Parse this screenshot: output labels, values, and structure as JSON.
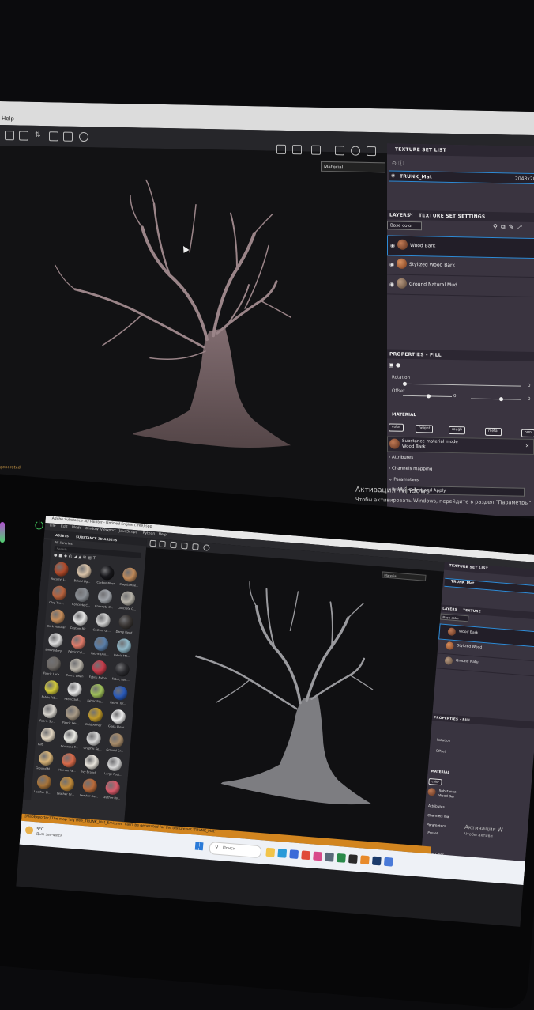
{
  "monitor": {
    "menu": "Help",
    "material_select": "Material",
    "texture_set_list": {
      "title": "TEXTURE SET LIST",
      "item_name": "TRUNK_Mat",
      "item_size": "2048x20"
    },
    "tabs": {
      "layers": "LAYERS",
      "settings": "TEXTURE SET SETTINGS"
    },
    "channel_select": "Base color",
    "layers": [
      "Wood Bark",
      "Stylized Wood Bark",
      "Ground Natural Mud"
    ],
    "properties": {
      "title": "PROPERTIES - FILL",
      "rotation_label": "Rotation",
      "rotation_value": "0",
      "offset_label": "Offset",
      "offset_value_1": "0",
      "offset_value_2": "0",
      "material_title": "MATERIAL",
      "chips": [
        "color",
        "height",
        "rough",
        "metal",
        "nrm"
      ],
      "substance_mode": "Substance material mode",
      "substance_name": "Wood Bark",
      "attributes": "Attributes",
      "channels_mapping": "Channels mapping",
      "parameters": "Parameters",
      "preset_label": "Preset",
      "preset_value": "Select and Apply"
    },
    "watermark_title": "Активация Windows",
    "watermark_sub": "Чтобы активировать Windows, перейдите в раздел \"Параметры\"",
    "left_edge_text": "generated"
  },
  "laptop": {
    "app_title": "Adobe Substance 3D Painter - Untitled Engine (Tree).spp",
    "menu": [
      "File",
      "Edit",
      "Mode",
      "Window",
      "Viewport",
      "JavaScript",
      "Python",
      "Help"
    ],
    "asset_tabs": [
      "ASSETS",
      "SUBSTANCE 3D ASSETS"
    ],
    "all_libraries": "All libraries",
    "search_placeholder": "Search",
    "assets": [
      {
        "label": "Autumn L...",
        "color": "#b04a2a"
      },
      {
        "label": "Baked Lig...",
        "color": "#d8c2a8"
      },
      {
        "label": "Carbon Fiber",
        "color": "#18181c"
      },
      {
        "label": "Clay Earthe...",
        "color": "#c08a5a"
      },
      {
        "label": "Clay Terr...",
        "color": "#b8633e"
      },
      {
        "label": "Concrete C...",
        "color": "#8a8e94"
      },
      {
        "label": "Concrete C...",
        "color": "#a0a4aa"
      },
      {
        "label": "Concrete C...",
        "color": "#b6b2a8"
      },
      {
        "label": "Cork Natural",
        "color": "#c48c5a"
      },
      {
        "label": "Custom Bit...",
        "color": "#e6e6e6"
      },
      {
        "label": "Custom Gr...",
        "color": "#cfcfcf"
      },
      {
        "label": "Damp Road",
        "color": "#3a3634"
      },
      {
        "label": "Embroidery",
        "color": "#dcdcdc"
      },
      {
        "label": "Fabric Col...",
        "color": "#e07b6a"
      },
      {
        "label": "Fabric Den...",
        "color": "#5a7ea8"
      },
      {
        "label": "Fabric Mil...",
        "color": "#8fb8c8"
      },
      {
        "label": "Fabric Lace",
        "color": "#6e6a66"
      },
      {
        "label": "Fabric Linen",
        "color": "#b9b4aa"
      },
      {
        "label": "Fabric Nylon",
        "color": "#c83c4a"
      },
      {
        "label": "Fabric Rou...",
        "color": "#2a2a2e"
      },
      {
        "label": "Fabric Rib...",
        "color": "#d0c83a"
      },
      {
        "label": "Fabric Sof...",
        "color": "#e8e8e8"
      },
      {
        "label": "Fabric Sta...",
        "color": "#9fc05a"
      },
      {
        "label": "Fabric Tar...",
        "color": "#2a5ab8"
      },
      {
        "label": "Fabric Sp...",
        "color": "#d6d2cc"
      },
      {
        "label": "Fabric Wo...",
        "color": "#a89a86"
      },
      {
        "label": "Gold Armor",
        "color": "#c09a2a"
      },
      {
        "label": "Glass Clear",
        "color": "#f0f0f0"
      },
      {
        "label": "Gilt",
        "color": "#e2d6c2"
      },
      {
        "label": "Gouache P...",
        "color": "#ecece6"
      },
      {
        "label": "Graphic Se...",
        "color": "#d8d8d8"
      },
      {
        "label": "Ground Gr...",
        "color": "#a88c6a"
      },
      {
        "label": "Ground M...",
        "color": "#d8b478"
      },
      {
        "label": "Human Fa...",
        "color": "#d86a4a"
      },
      {
        "label": "Ivy Branch",
        "color": "#e8e4dc"
      },
      {
        "label": "Large Rust...",
        "color": "#d8d8d8"
      },
      {
        "label": "Leather Bl...",
        "color": "#a8743a"
      },
      {
        "label": "Leather Gr...",
        "color": "#c08a3a"
      },
      {
        "label": "Leather Ha...",
        "color": "#b86a3a"
      },
      {
        "label": "Leather Ro...",
        "color": "#d85a6a"
      }
    ],
    "material_select": "Material",
    "texture_set_list": "TEXTURE SET LIST",
    "texture_item": "TRUNK_Mat",
    "tabs": [
      "LAYERS",
      "TEXTURE"
    ],
    "channel_select": "Base color",
    "layers": [
      "Wood Bark",
      "Stylized Wood",
      "Ground Natu"
    ],
    "properties_title": "PROPERTIES - FILL",
    "rotation": "Rotation",
    "offset": "Offset",
    "material_title": "MATERIAL",
    "chip": "color",
    "substance": "Substance",
    "substance_name": "Wood Bar",
    "attributes": "Attributes",
    "channels": "Channels ma",
    "parameters": "Parameters",
    "preset": "Preset",
    "base_color": "Base Color",
    "error_text": "[MapExporter] The map 'big tree_TRUNK_Mat_Emissive' can't be generated for the texture set 'TRUNK_Mat'.",
    "watermark_title": "Активация W",
    "watermark_sub": "Чтобы активи",
    "weather_temp": "5°C",
    "weather_desc": "Дым засчился",
    "search_text": "Поиск",
    "taskbar_apps": [
      {
        "icon": "file-explorer-icon",
        "color": "#f2c44a"
      },
      {
        "icon": "edge-icon",
        "color": "#2a9ad8"
      },
      {
        "icon": "store-icon",
        "color": "#3a6ad8"
      },
      {
        "icon": "chrome-icon",
        "color": "#e04a3a"
      },
      {
        "icon": "photos-icon",
        "color": "#d84a8a"
      },
      {
        "icon": "settings-icon",
        "color": "#5a6a7a"
      },
      {
        "icon": "app-icon",
        "color": "#2a8a4a"
      },
      {
        "icon": "substance-icon",
        "color": "#2a2a2a"
      },
      {
        "icon": "blender-icon",
        "color": "#e88a2a"
      },
      {
        "icon": "steam-icon",
        "color": "#1a3a6a"
      },
      {
        "icon": "tiles-icon",
        "color": "#4a7ad8"
      }
    ]
  }
}
